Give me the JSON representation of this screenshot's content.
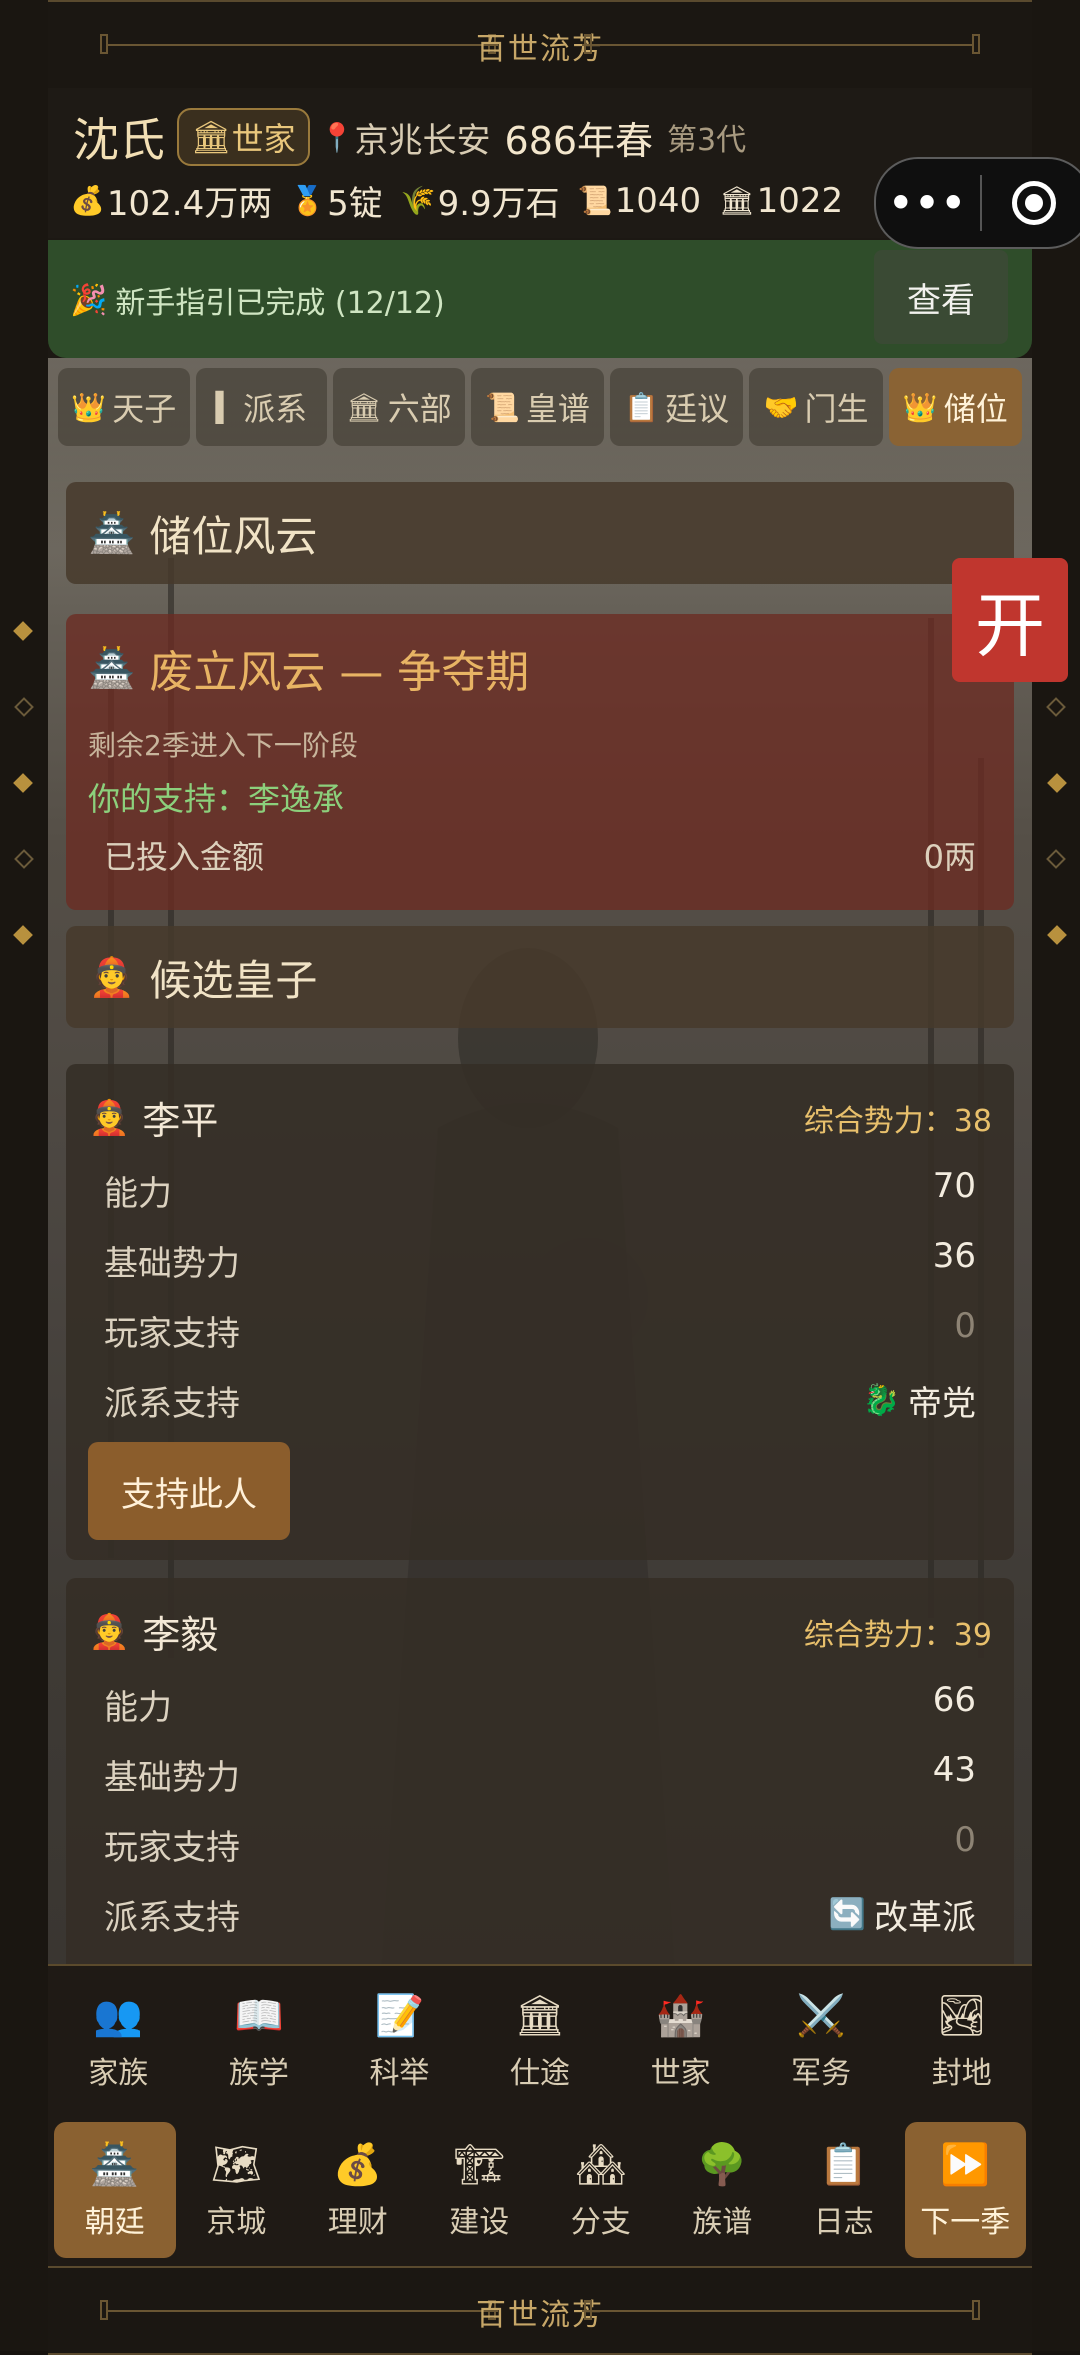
{
  "banner": {
    "title": "百世流芳"
  },
  "header": {
    "family_name": "沈氏",
    "rank": {
      "icon": "🏛",
      "label": "世家"
    },
    "location": {
      "icon": "📍",
      "label": "京兆长安"
    },
    "year": "686年春",
    "generation": "第3代",
    "resources": [
      {
        "icon": "💰",
        "value": "102.4万两"
      },
      {
        "icon": "🏅",
        "value": "5锭"
      },
      {
        "icon": "🌾",
        "value": "9.9万石"
      },
      {
        "icon": "📜",
        "value": "1040"
      },
      {
        "icon": "🏛",
        "value": "1022"
      }
    ]
  },
  "guide": {
    "icon": "🎉",
    "text": "新手指引已完成 (12/12)",
    "button": "查看"
  },
  "tabs": [
    {
      "icon": "👑",
      "label": "天子"
    },
    {
      "icon": "▍",
      "label": "派系"
    },
    {
      "icon": "🏛",
      "label": "六部"
    },
    {
      "icon": "📜",
      "label": "皇谱"
    },
    {
      "icon": "📋",
      "label": "廷议"
    },
    {
      "icon": "🤝",
      "label": "门生"
    },
    {
      "icon": "👑",
      "label": "储位"
    }
  ],
  "succession": {
    "icon": "🏯",
    "title": "储位风云"
  },
  "fight": {
    "icon": "🏯",
    "title": "废立风云 — 争夺期",
    "subtitle": "剩余2季进入下一阶段",
    "support": "你的支持：李逸承",
    "invested_label": "已投入金额",
    "invested_value": "0两"
  },
  "candidates_header": {
    "icon": "👲",
    "title": "候选皇子"
  },
  "princes": [
    {
      "icon": "👲",
      "name": "李平",
      "power": "综合势力：38",
      "ability_label": "能力",
      "ability": "70",
      "base_label": "基础势力",
      "base": "36",
      "player_label": "玩家支持",
      "player": "0",
      "faction_label": "派系支持",
      "faction_icon": "🐉",
      "faction": "帝党",
      "button": "支持此人"
    },
    {
      "icon": "👲",
      "name": "李毅",
      "power": "综合势力：39",
      "ability_label": "能力",
      "ability": "66",
      "base_label": "基础势力",
      "base": "43",
      "player_label": "玩家支持",
      "player": "0",
      "faction_label": "派系支持",
      "faction_icon": "🔄",
      "faction": "改革派"
    }
  ],
  "open_button": "开",
  "nav_top": [
    {
      "icon": "👥",
      "label": "家族"
    },
    {
      "icon": "📖",
      "label": "族学"
    },
    {
      "icon": "📝",
      "label": "科举"
    },
    {
      "icon": "🏛",
      "label": "仕途"
    },
    {
      "icon": "🏰",
      "label": "世家"
    },
    {
      "icon": "⚔️",
      "label": "军务"
    },
    {
      "icon": "🏞",
      "label": "封地"
    }
  ],
  "nav_bottom": [
    {
      "icon": "🏯",
      "label": "朝廷"
    },
    {
      "icon": "🗺",
      "label": "京城"
    },
    {
      "icon": "💰",
      "label": "理财"
    },
    {
      "icon": "🏗",
      "label": "建设"
    },
    {
      "icon": "🏘",
      "label": "分支"
    },
    {
      "icon": "🌳",
      "label": "族谱"
    },
    {
      "icon": "📋",
      "label": "日志"
    },
    {
      "icon": "⏩",
      "label": "下一季"
    }
  ]
}
